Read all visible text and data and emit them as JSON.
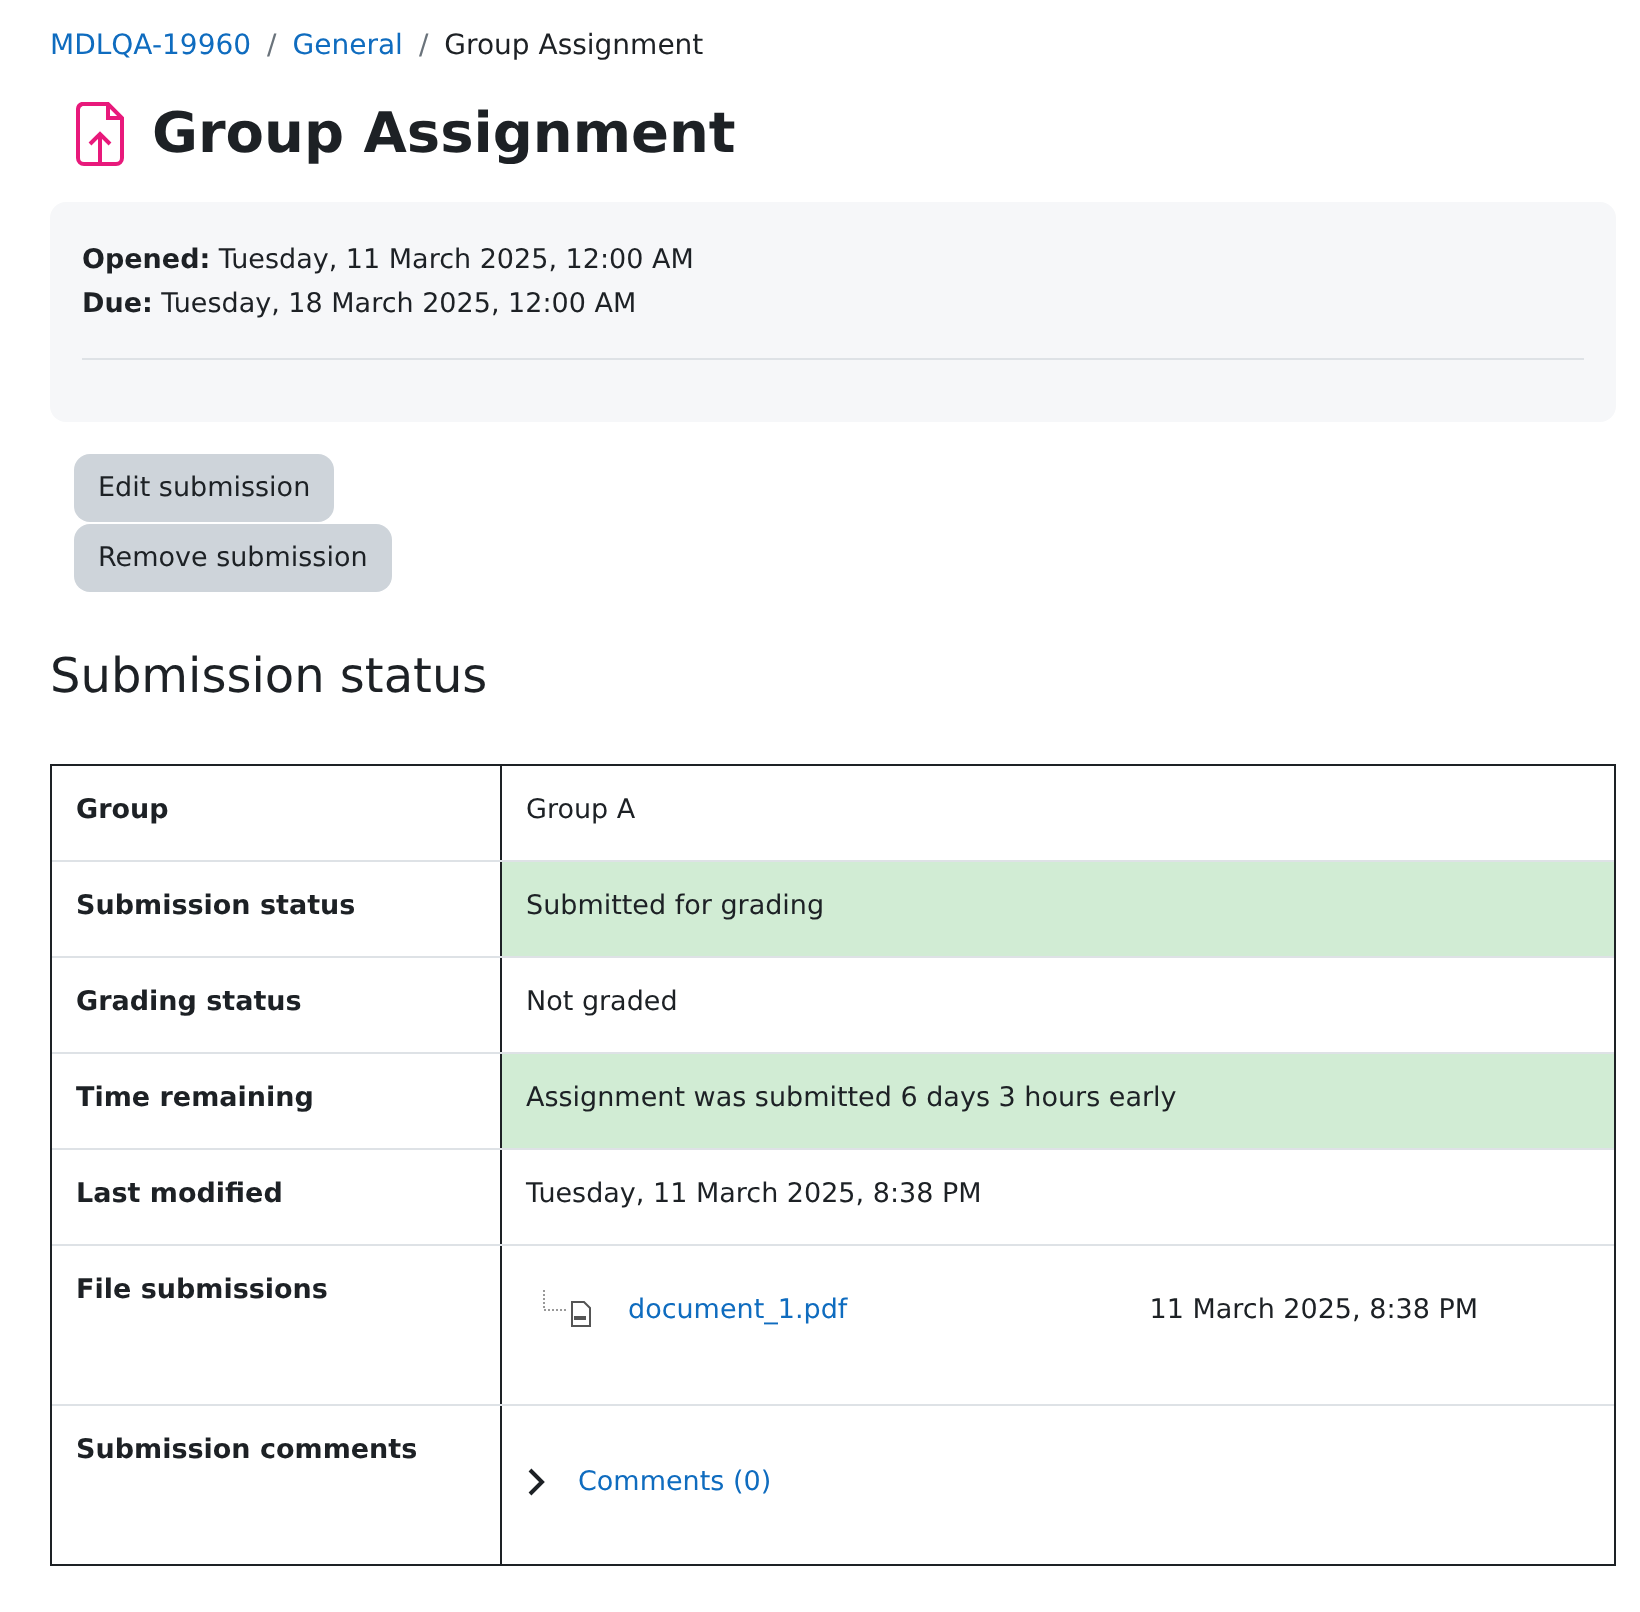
{
  "breadcrumb": [
    {
      "label": "MDLQA-19960",
      "link": true
    },
    {
      "separator": "/",
      "label": "General",
      "link": true
    },
    {
      "separator": "/",
      "label": "Group Assignment",
      "link": false
    }
  ],
  "title": "Group Assignment",
  "dates": [
    {
      "label": "Opened:",
      "value": "Tuesday, 11 March 2025, 12:00 AM"
    },
    {
      "label": "Due:",
      "value": "Tuesday, 18 March 2025, 12:00 AM"
    }
  ],
  "buttons": [
    "Edit submission",
    "Remove submission"
  ],
  "section_title": "Submission status",
  "rows": [
    {
      "kind": "text",
      "label": "Group",
      "value": "Group A",
      "highlight": false
    },
    {
      "kind": "text",
      "label": "Submission status",
      "value": "Submitted for grading",
      "highlight": true
    },
    {
      "kind": "text",
      "label": "Grading status",
      "value": "Not graded",
      "highlight": false
    },
    {
      "kind": "text",
      "label": "Time remaining",
      "value": "Assignment was submitted 6 days 3 hours early",
      "highlight": true
    },
    {
      "kind": "text",
      "label": "Last modified",
      "value": "Tuesday, 11 March 2025, 8:38 PM",
      "highlight": false
    },
    {
      "kind": "file",
      "label": "File submissions",
      "file": "document_1.pdf",
      "date": "11 March 2025, 8:38 PM",
      "highlight": false
    },
    {
      "kind": "comments",
      "label": "Submission comments",
      "link": "Comments (0)",
      "expanded": false,
      "highlight": false
    }
  ]
}
